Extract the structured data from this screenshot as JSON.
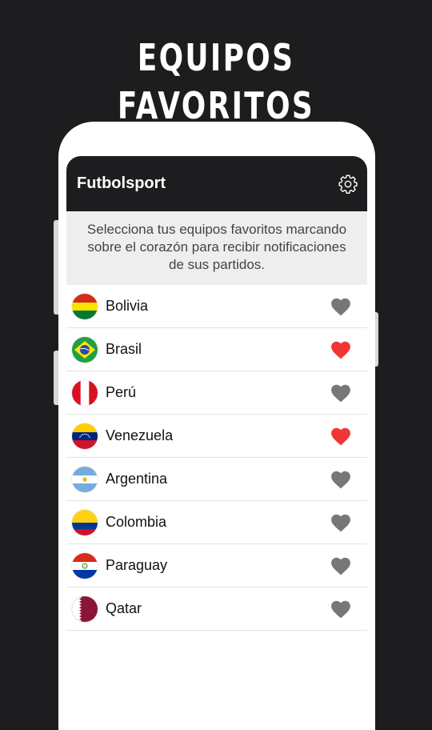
{
  "promo": {
    "title": "EQUIPOS FAVORITOS"
  },
  "app": {
    "title": "Futbolsport",
    "settings_icon": "gear-icon",
    "intro": "Selecciona tus equipos favoritos marcando sobre el corazón para recibir notificaciones de sus partidos."
  },
  "colors": {
    "heart_active": "#f23535",
    "heart_inactive": "#777777",
    "appbar": "#1d1d1f"
  },
  "teams": [
    {
      "name": "Bolivia",
      "flag": "bolivia",
      "favorite": false
    },
    {
      "name": "Brasil",
      "flag": "brasil",
      "favorite": true
    },
    {
      "name": "Perú",
      "flag": "peru",
      "favorite": false
    },
    {
      "name": "Venezuela",
      "flag": "venezuela",
      "favorite": true
    },
    {
      "name": "Argentina",
      "flag": "argentina",
      "favorite": false
    },
    {
      "name": "Colombia",
      "flag": "colombia",
      "favorite": false
    },
    {
      "name": "Paraguay",
      "flag": "paraguay",
      "favorite": false
    },
    {
      "name": "Qatar",
      "flag": "qatar",
      "favorite": false
    }
  ]
}
